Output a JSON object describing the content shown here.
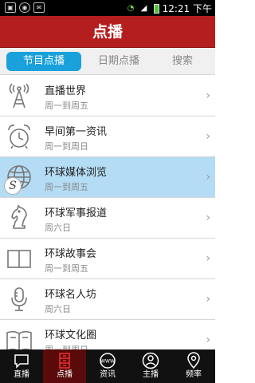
{
  "status_bar": {
    "time": "12:21 下午",
    "left_icons": [
      "image-icon",
      "media-icon",
      "mail-icon"
    ]
  },
  "header": {
    "title": "点播"
  },
  "tabs": [
    {
      "label": "节目点播",
      "active": true
    },
    {
      "label": "日期点播",
      "active": false
    },
    {
      "label": "搜索",
      "active": false
    }
  ],
  "list": [
    {
      "title": "直播世界",
      "schedule": "周一到周五",
      "icon": "radio-tower-icon",
      "selected": false
    },
    {
      "title": "早间第一资讯",
      "schedule": "周一到周日",
      "icon": "alarm-clock-icon",
      "selected": false
    },
    {
      "title": "环球媒体浏览",
      "schedule": "周一到周五",
      "icon": "globe-icon",
      "selected": true
    },
    {
      "title": "环球军事报道",
      "schedule": "周六日",
      "icon": "chess-knight-icon",
      "selected": false
    },
    {
      "title": "环球故事会",
      "schedule": "周一到周五",
      "icon": "book-icon",
      "selected": false
    },
    {
      "title": "环球名人坊",
      "schedule": "周六日",
      "icon": "microphone-icon",
      "selected": false
    },
    {
      "title": "环球文化圈",
      "schedule": "周一到周日",
      "icon": "open-book-icon",
      "selected": false
    }
  ],
  "floating_badge": "S",
  "bottom_nav": [
    {
      "label": "直播",
      "icon": "chat-bubble-icon",
      "active": false
    },
    {
      "label": "点播",
      "icon": "cabinet-icon",
      "active": true
    },
    {
      "label": "资讯",
      "icon": "www-globe-icon",
      "active": false
    },
    {
      "label": "主播",
      "icon": "user-icon",
      "active": false
    },
    {
      "label": "频率",
      "icon": "location-pin-icon",
      "active": false
    }
  ],
  "colors": {
    "header": "#b51e1e",
    "tab_active": "#1aa1dc",
    "selected_row": "#b4dcf4",
    "nav_active": "#5a0a0a"
  }
}
